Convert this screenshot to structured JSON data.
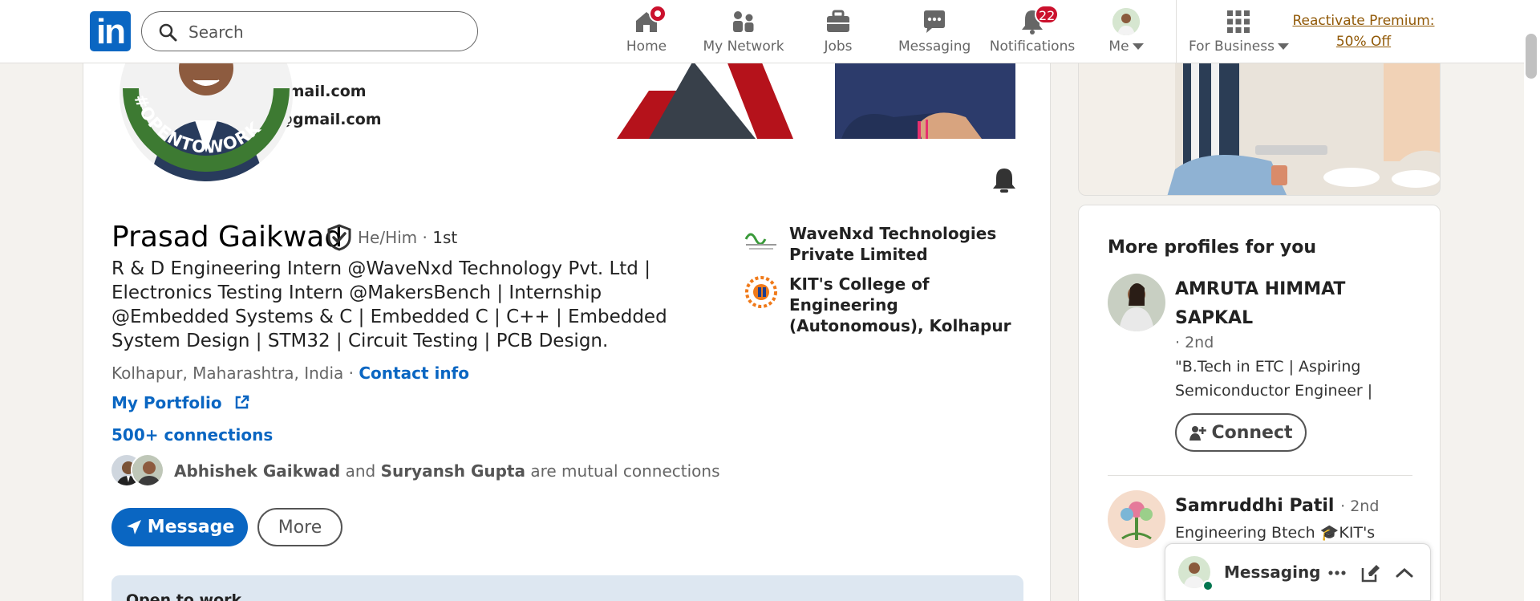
{
  "nav": {
    "logo_text": "in",
    "search_placeholder": "Search",
    "items": [
      {
        "label": "Home",
        "badge": ""
      },
      {
        "label": "My Network",
        "badge": ""
      },
      {
        "label": "Jobs",
        "badge": ""
      },
      {
        "label": "Messaging",
        "badge": ""
      },
      {
        "label": "Notifications",
        "badge": "22"
      },
      {
        "label": "Me",
        "badge": ""
      },
      {
        "label": "For Business",
        "badge": ""
      }
    ],
    "premium_line1": "Reactivate Premium:",
    "premium_line2": "50% Off"
  },
  "profile": {
    "email1": "gmail.com",
    "email2": "@gmail.com",
    "name": "Prasad Gaikwad",
    "pronouns": "He/Him",
    "separator": " · ",
    "degree": "1st",
    "headline": "R & D Engineering Intern @WaveNxd Technology Pvt. Ltd | Electronics Testing Intern @MakersBench | Internship @Embedded Systems & C | Embedded C | C++ | Embedded System Design | STM32 | Circuit Testing | PCB Design.",
    "location": "Kolhapur, Maharashtra, India",
    "contact_info": "Contact info",
    "portfolio": "My Portfolio",
    "connections": "500+ connections",
    "mutual_name1": "Abhishek Gaikwad",
    "mutual_and": " and ",
    "mutual_name2": "Suryansh Gupta",
    "mutual_suffix": " are mutual connections",
    "message_button": "Message",
    "more_button": "More",
    "open_to_work": "Open to work",
    "companies": [
      {
        "name": "WaveNxd Technologies Private Limited"
      },
      {
        "name": "KIT's College of Engineering (Autonomous), Kolhapur"
      }
    ]
  },
  "sidebar": {
    "title": "More profiles for you",
    "profiles": [
      {
        "name": "AMRUTA HIMMAT SAPKAL",
        "degree": "· 2nd",
        "headline": "\"B.Tech in ETC | Aspiring Semiconductor Engineer | VLS...",
        "button": "Connect"
      },
      {
        "name": "Samruddhi Patil",
        "degree": "· 2nd",
        "headline": "Engineering Btech 🎓KIT's"
      }
    ]
  },
  "messaging": {
    "title": "Messaging"
  },
  "colors": {
    "brand": "#0a66c2",
    "badge": "#cb112d",
    "premium": "#915907",
    "otw_green": "#3d7a32"
  }
}
